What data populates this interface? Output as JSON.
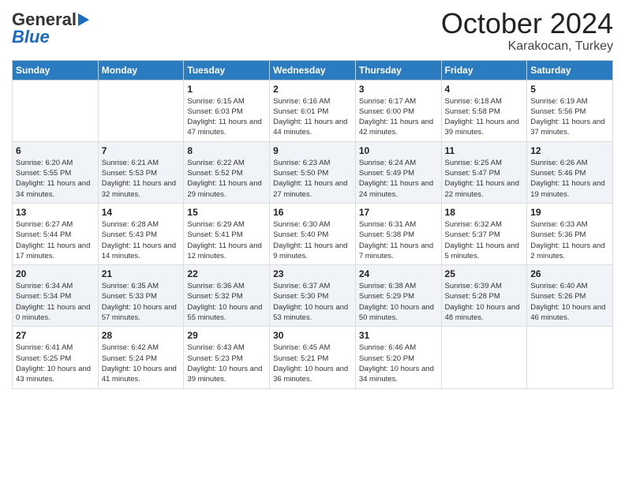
{
  "logo": {
    "line1": "General",
    "line2": "Blue",
    "tagline": ""
  },
  "title": "October 2024",
  "subtitle": "Karakocan, Turkey",
  "headers": [
    "Sunday",
    "Monday",
    "Tuesday",
    "Wednesday",
    "Thursday",
    "Friday",
    "Saturday"
  ],
  "weeks": [
    [
      {
        "day": "",
        "info": ""
      },
      {
        "day": "",
        "info": ""
      },
      {
        "day": "1",
        "info": "Sunrise: 6:15 AM\nSunset: 6:03 PM\nDaylight: 11 hours and 47 minutes."
      },
      {
        "day": "2",
        "info": "Sunrise: 6:16 AM\nSunset: 6:01 PM\nDaylight: 11 hours and 44 minutes."
      },
      {
        "day": "3",
        "info": "Sunrise: 6:17 AM\nSunset: 6:00 PM\nDaylight: 11 hours and 42 minutes."
      },
      {
        "day": "4",
        "info": "Sunrise: 6:18 AM\nSunset: 5:58 PM\nDaylight: 11 hours and 39 minutes."
      },
      {
        "day": "5",
        "info": "Sunrise: 6:19 AM\nSunset: 5:56 PM\nDaylight: 11 hours and 37 minutes."
      }
    ],
    [
      {
        "day": "6",
        "info": "Sunrise: 6:20 AM\nSunset: 5:55 PM\nDaylight: 11 hours and 34 minutes."
      },
      {
        "day": "7",
        "info": "Sunrise: 6:21 AM\nSunset: 5:53 PM\nDaylight: 11 hours and 32 minutes."
      },
      {
        "day": "8",
        "info": "Sunrise: 6:22 AM\nSunset: 5:52 PM\nDaylight: 11 hours and 29 minutes."
      },
      {
        "day": "9",
        "info": "Sunrise: 6:23 AM\nSunset: 5:50 PM\nDaylight: 11 hours and 27 minutes."
      },
      {
        "day": "10",
        "info": "Sunrise: 6:24 AM\nSunset: 5:49 PM\nDaylight: 11 hours and 24 minutes."
      },
      {
        "day": "11",
        "info": "Sunrise: 6:25 AM\nSunset: 5:47 PM\nDaylight: 11 hours and 22 minutes."
      },
      {
        "day": "12",
        "info": "Sunrise: 6:26 AM\nSunset: 5:46 PM\nDaylight: 11 hours and 19 minutes."
      }
    ],
    [
      {
        "day": "13",
        "info": "Sunrise: 6:27 AM\nSunset: 5:44 PM\nDaylight: 11 hours and 17 minutes."
      },
      {
        "day": "14",
        "info": "Sunrise: 6:28 AM\nSunset: 5:43 PM\nDaylight: 11 hours and 14 minutes."
      },
      {
        "day": "15",
        "info": "Sunrise: 6:29 AM\nSunset: 5:41 PM\nDaylight: 11 hours and 12 minutes."
      },
      {
        "day": "16",
        "info": "Sunrise: 6:30 AM\nSunset: 5:40 PM\nDaylight: 11 hours and 9 minutes."
      },
      {
        "day": "17",
        "info": "Sunrise: 6:31 AM\nSunset: 5:38 PM\nDaylight: 11 hours and 7 minutes."
      },
      {
        "day": "18",
        "info": "Sunrise: 6:32 AM\nSunset: 5:37 PM\nDaylight: 11 hours and 5 minutes."
      },
      {
        "day": "19",
        "info": "Sunrise: 6:33 AM\nSunset: 5:36 PM\nDaylight: 11 hours and 2 minutes."
      }
    ],
    [
      {
        "day": "20",
        "info": "Sunrise: 6:34 AM\nSunset: 5:34 PM\nDaylight: 11 hours and 0 minutes."
      },
      {
        "day": "21",
        "info": "Sunrise: 6:35 AM\nSunset: 5:33 PM\nDaylight: 10 hours and 57 minutes."
      },
      {
        "day": "22",
        "info": "Sunrise: 6:36 AM\nSunset: 5:32 PM\nDaylight: 10 hours and 55 minutes."
      },
      {
        "day": "23",
        "info": "Sunrise: 6:37 AM\nSunset: 5:30 PM\nDaylight: 10 hours and 53 minutes."
      },
      {
        "day": "24",
        "info": "Sunrise: 6:38 AM\nSunset: 5:29 PM\nDaylight: 10 hours and 50 minutes."
      },
      {
        "day": "25",
        "info": "Sunrise: 6:39 AM\nSunset: 5:28 PM\nDaylight: 10 hours and 48 minutes."
      },
      {
        "day": "26",
        "info": "Sunrise: 6:40 AM\nSunset: 5:26 PM\nDaylight: 10 hours and 46 minutes."
      }
    ],
    [
      {
        "day": "27",
        "info": "Sunrise: 6:41 AM\nSunset: 5:25 PM\nDaylight: 10 hours and 43 minutes."
      },
      {
        "day": "28",
        "info": "Sunrise: 6:42 AM\nSunset: 5:24 PM\nDaylight: 10 hours and 41 minutes."
      },
      {
        "day": "29",
        "info": "Sunrise: 6:43 AM\nSunset: 5:23 PM\nDaylight: 10 hours and 39 minutes."
      },
      {
        "day": "30",
        "info": "Sunrise: 6:45 AM\nSunset: 5:21 PM\nDaylight: 10 hours and 36 minutes."
      },
      {
        "day": "31",
        "info": "Sunrise: 6:46 AM\nSunset: 5:20 PM\nDaylight: 10 hours and 34 minutes."
      },
      {
        "day": "",
        "info": ""
      },
      {
        "day": "",
        "info": ""
      }
    ]
  ]
}
